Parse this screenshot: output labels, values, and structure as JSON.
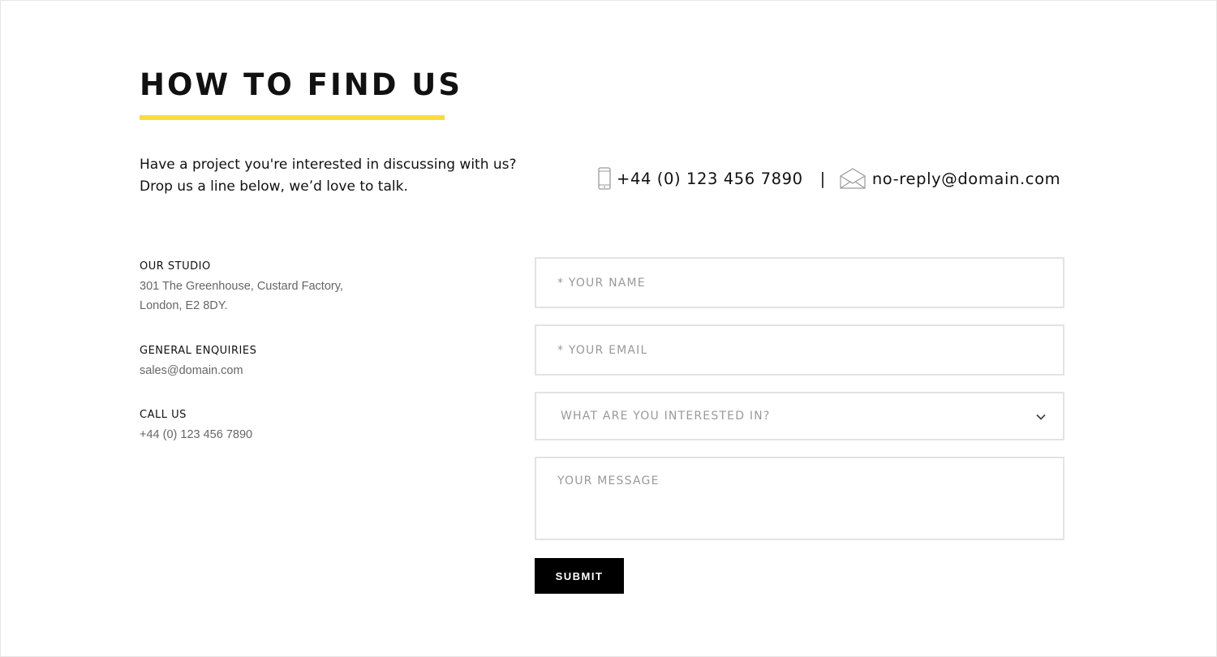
{
  "section": {
    "title": "HOW TO FIND US",
    "intro": "Have a project you're interested in discussing with us? Drop us a line below, we’d love to talk."
  },
  "contact_strip": {
    "phone_icon": "phone-icon",
    "phone": "+44 (0) 123 456 7890",
    "separator": "|",
    "mail_icon": "envelope-icon",
    "email": "no-reply@domain.com"
  },
  "info": {
    "studio": {
      "heading": "OUR STUDIO",
      "line1": "301 The Greenhouse, Custard Factory,",
      "line2": "London, E2 8DY."
    },
    "enquiries": {
      "heading": "GENERAL ENQUIRIES",
      "value": "sales@domain.com"
    },
    "call": {
      "heading": "CALL US",
      "value": "+44 (0) 123 456 7890"
    }
  },
  "form": {
    "name_placeholder": "* YOUR NAME",
    "email_placeholder": "* YOUR EMAIL",
    "interest_placeholder": "WHAT ARE YOU INTERESTED IN?",
    "message_placeholder": "YOUR MESSAGE",
    "submit_label": "SUBMIT"
  },
  "colors": {
    "accent": "#fbdd3a",
    "text": "#111111",
    "muted": "#666666",
    "placeholder": "#999999",
    "border": "#e3e3e3",
    "button": "#000000"
  }
}
